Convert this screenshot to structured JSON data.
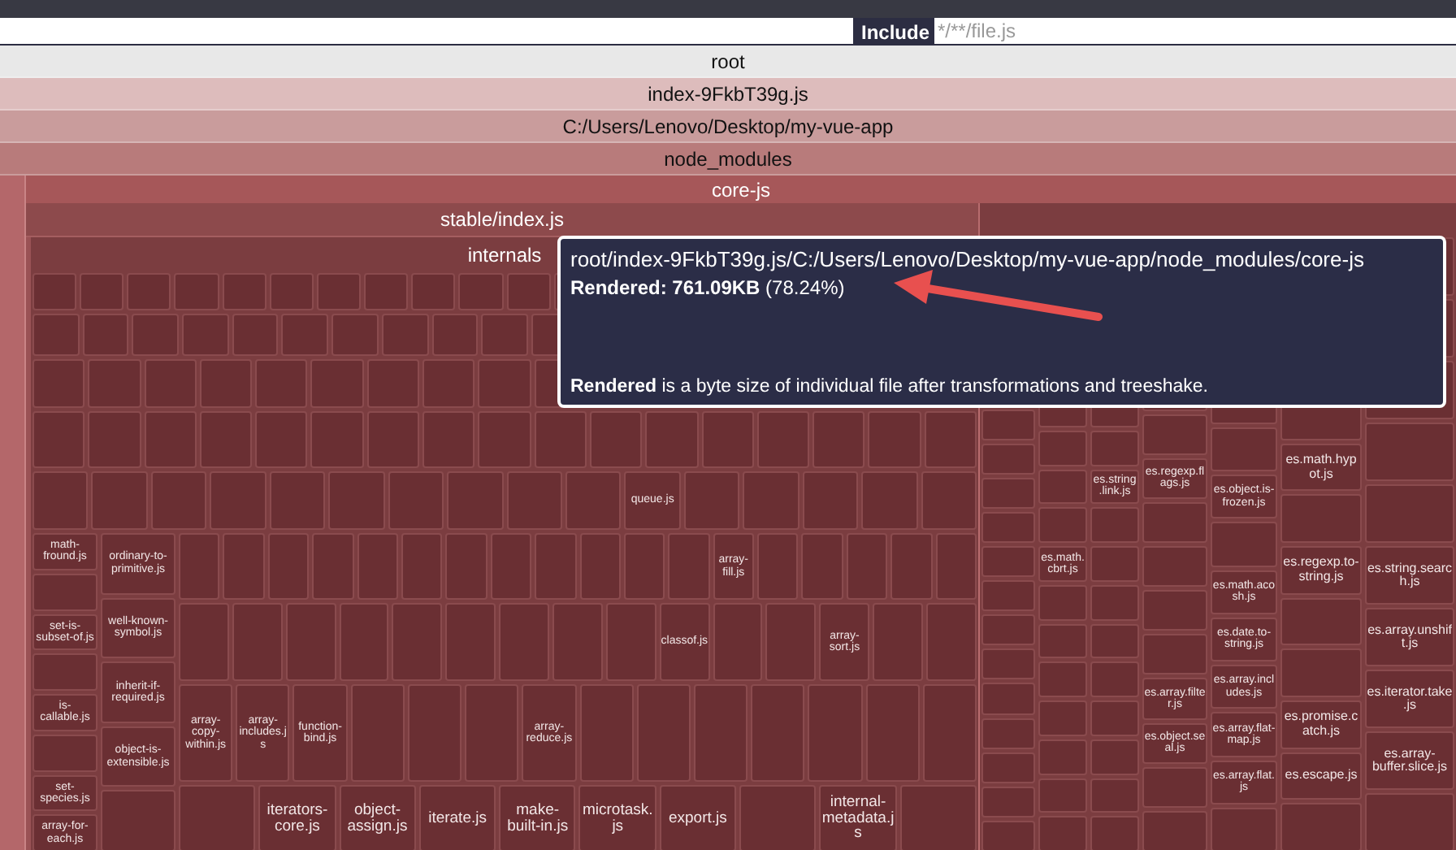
{
  "filters": {
    "include_label": "Include",
    "include_placeholder": "*/**/file.js"
  },
  "path_bands": [
    "root",
    "index-9FkbT39g.js",
    "C:/Users/Lenovo/Desktop/my-vue-app",
    "node_modules"
  ],
  "treemap": {
    "label": "core-js",
    "stable": {
      "label": "stable/index.js",
      "internals": {
        "label": "internals",
        "top_rows": [
          {},
          {},
          {},
          {},
          {
            "labels": [
              "queue.js"
            ]
          }
        ],
        "left_column_a": [
          "math-fround.js",
          "set-is-subset-of.js",
          "is-callable.js",
          "set-species.js",
          "array-for-each.js"
        ],
        "left_column_b": [
          "ordinary-to-primitive.js",
          "well-known-symbol.js",
          "inherit-if-required.js",
          "object-is-extensible.js"
        ],
        "rows": [
          {
            "labels": [
              "array-fill.js"
            ]
          },
          {
            "labels": [
              "classof.js",
              "array-sort.js"
            ]
          },
          {
            "labels": [
              "array-copy-within.js",
              "array-includes.js",
              "function-bind.js",
              "array-reduce.js"
            ]
          },
          {
            "labels": [
              "iterators-core.js",
              "object-assign.js",
              "iterate.js",
              "make-built-in.js",
              "microtask.js",
              "export.js",
              "internal-metadata.js"
            ]
          }
        ]
      }
    },
    "modules_columns": [
      {},
      {
        "labels": [
          "es.math.cbrt.js"
        ]
      },
      {
        "labels": [
          "es.string.link.js"
        ]
      },
      {
        "labels": [
          "es.regexp.flags.js",
          "es.array.filter.js",
          "es.object.seal.js"
        ]
      },
      {
        "labels": [
          "es.object.is-frozen.js",
          "es.math.acosh.js",
          "es.date.to-string.js",
          "es.array.includes.js",
          "es.array.flat-map.js",
          "es.array.flat.js"
        ]
      },
      {
        "labels": [
          "es.math.hypot.js",
          "es.regexp.to-string.js",
          "es.promise.catch.js",
          "es.escape.js"
        ]
      },
      {
        "labels": [
          "es.string.search.js",
          "es.array.unshift.js",
          "es.iterator.take.js",
          "es.array-buffer.slice.js"
        ]
      }
    ]
  },
  "tooltip": {
    "path": "root/index-9FkbT39g.js/C:/Users/Lenovo/Desktop/my-vue-app/node_modules/core-js",
    "rendered": "**Rendered: 761.09KB** (78.24%)",
    "note": "**Rendered** is a byte size of individual file after transformations and treeshake."
  }
}
